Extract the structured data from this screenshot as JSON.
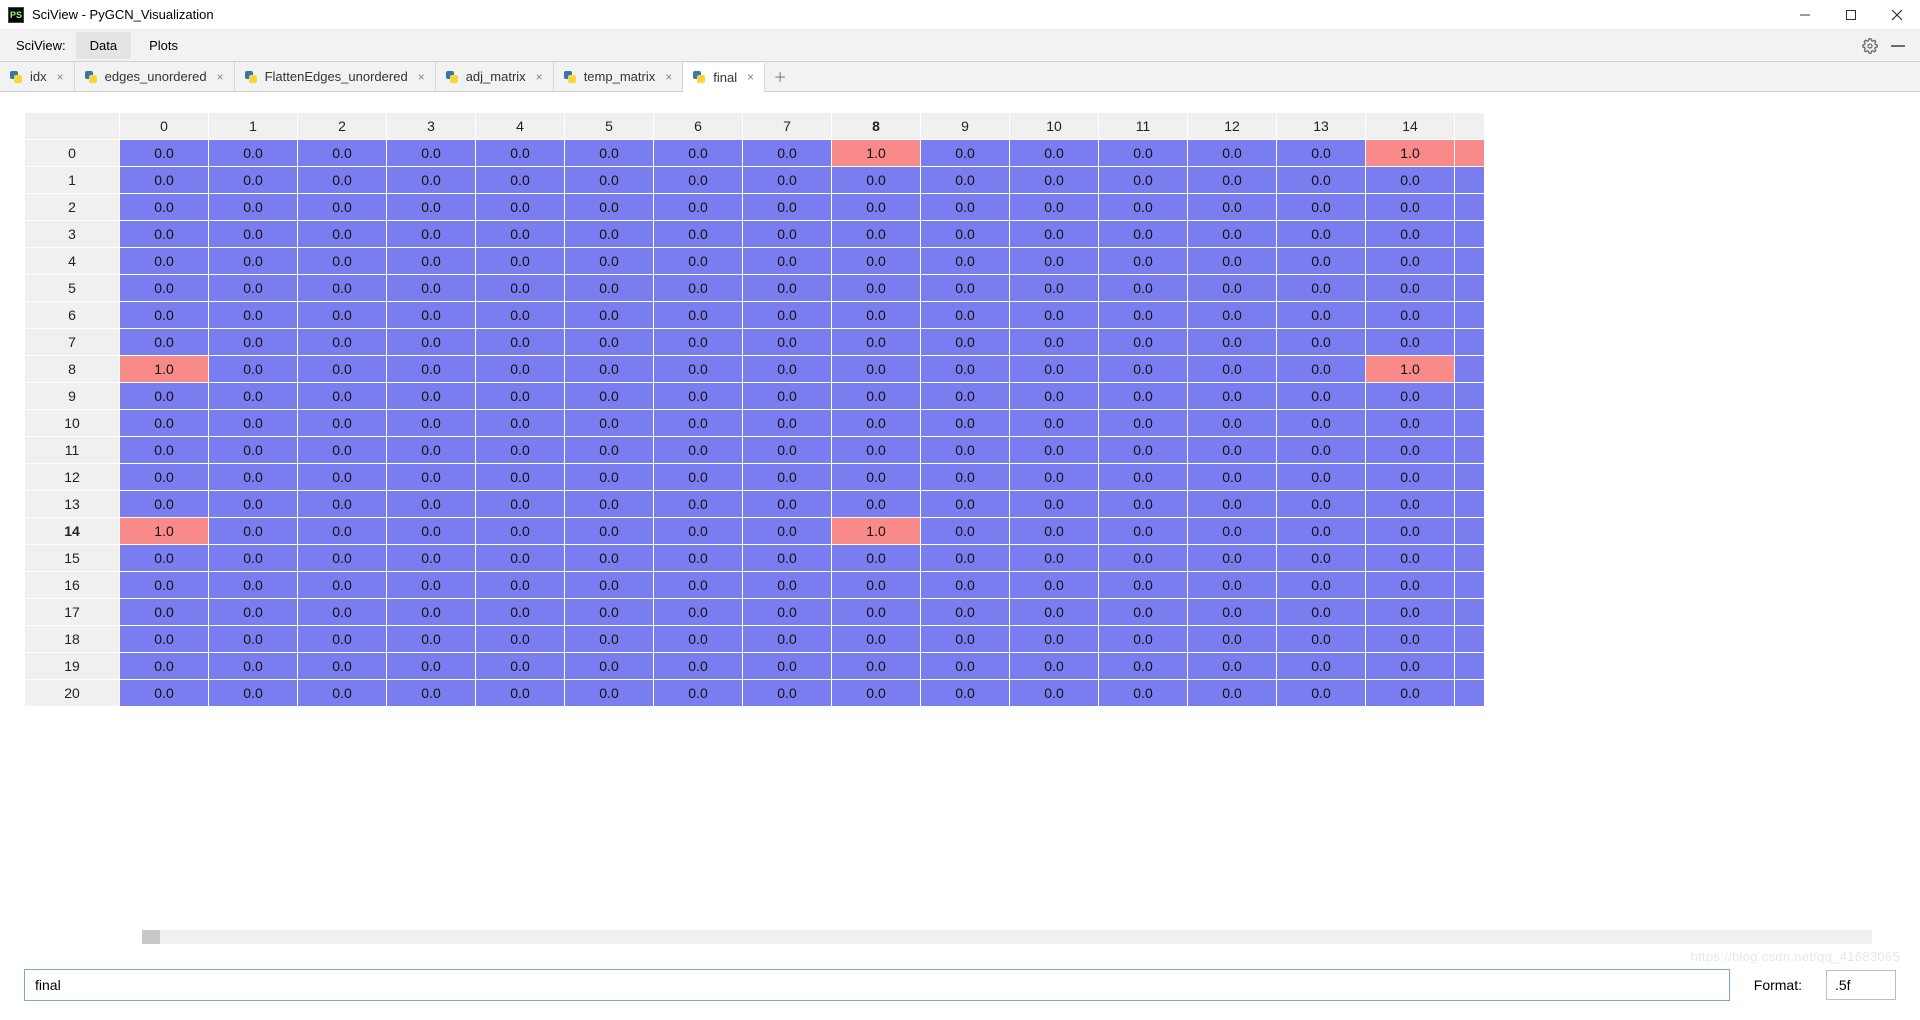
{
  "titlebar": {
    "app_icon": "PS",
    "title": "SciView - PyGCN_Visualization"
  },
  "menubar": {
    "label": "SciView:",
    "items": [
      {
        "label": "Data",
        "active": true
      },
      {
        "label": "Plots",
        "active": false
      }
    ]
  },
  "tabs": {
    "items": [
      {
        "label": "idx",
        "active": false
      },
      {
        "label": "edges_unordered",
        "active": false
      },
      {
        "label": "FlattenEdges_unordered",
        "active": false
      },
      {
        "label": "adj_matrix",
        "active": false
      },
      {
        "label": "temp_matrix",
        "active": false
      },
      {
        "label": "final",
        "active": true
      }
    ]
  },
  "grid": {
    "columns": [
      "0",
      "1",
      "2",
      "3",
      "4",
      "5",
      "6",
      "7",
      "8",
      "9",
      "10",
      "11",
      "12",
      "13",
      "14"
    ],
    "bold_column_index": 8,
    "bold_row_index": 14,
    "rows": [
      "0",
      "1",
      "2",
      "3",
      "4",
      "5",
      "6",
      "7",
      "8",
      "9",
      "10",
      "11",
      "12",
      "13",
      "14",
      "15",
      "16",
      "17",
      "18",
      "19",
      "20"
    ],
    "highlighted_cells": [
      {
        "row": 0,
        "col": 8
      },
      {
        "row": 0,
        "col": 14
      },
      {
        "row": 8,
        "col": 0
      },
      {
        "row": 8,
        "col": 14
      },
      {
        "row": 14,
        "col": 0
      },
      {
        "row": 14,
        "col": 8
      }
    ],
    "values": {
      "default": "0.0",
      "highlight": "1.0"
    },
    "edge_highlight_rows": [
      0
    ]
  },
  "bottom": {
    "expression_value": "final",
    "format_label": "Format:",
    "format_value": ".5f"
  },
  "watermark": "https://blog.csdn.net/qq_41683065"
}
